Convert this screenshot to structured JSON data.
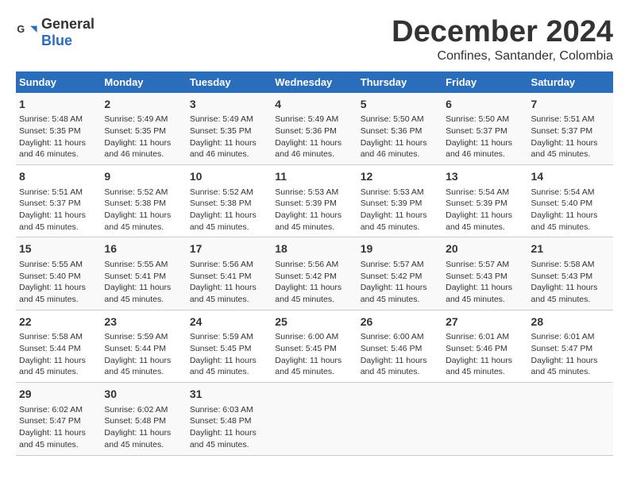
{
  "logo": {
    "general": "General",
    "blue": "Blue"
  },
  "title": "December 2024",
  "location": "Confines, Santander, Colombia",
  "days_header": [
    "Sunday",
    "Monday",
    "Tuesday",
    "Wednesday",
    "Thursday",
    "Friday",
    "Saturday"
  ],
  "weeks": [
    [
      {
        "day": 1,
        "rise": "5:48 AM",
        "set": "5:35 PM",
        "daylight": "11 hours and 46 minutes."
      },
      {
        "day": 2,
        "rise": "5:49 AM",
        "set": "5:35 PM",
        "daylight": "11 hours and 46 minutes."
      },
      {
        "day": 3,
        "rise": "5:49 AM",
        "set": "5:35 PM",
        "daylight": "11 hours and 46 minutes."
      },
      {
        "day": 4,
        "rise": "5:49 AM",
        "set": "5:36 PM",
        "daylight": "11 hours and 46 minutes."
      },
      {
        "day": 5,
        "rise": "5:50 AM",
        "set": "5:36 PM",
        "daylight": "11 hours and 46 minutes."
      },
      {
        "day": 6,
        "rise": "5:50 AM",
        "set": "5:37 PM",
        "daylight": "11 hours and 46 minutes."
      },
      {
        "day": 7,
        "rise": "5:51 AM",
        "set": "5:37 PM",
        "daylight": "11 hours and 45 minutes."
      }
    ],
    [
      {
        "day": 8,
        "rise": "5:51 AM",
        "set": "5:37 PM",
        "daylight": "11 hours and 45 minutes."
      },
      {
        "day": 9,
        "rise": "5:52 AM",
        "set": "5:38 PM",
        "daylight": "11 hours and 45 minutes."
      },
      {
        "day": 10,
        "rise": "5:52 AM",
        "set": "5:38 PM",
        "daylight": "11 hours and 45 minutes."
      },
      {
        "day": 11,
        "rise": "5:53 AM",
        "set": "5:39 PM",
        "daylight": "11 hours and 45 minutes."
      },
      {
        "day": 12,
        "rise": "5:53 AM",
        "set": "5:39 PM",
        "daylight": "11 hours and 45 minutes."
      },
      {
        "day": 13,
        "rise": "5:54 AM",
        "set": "5:39 PM",
        "daylight": "11 hours and 45 minutes."
      },
      {
        "day": 14,
        "rise": "5:54 AM",
        "set": "5:40 PM",
        "daylight": "11 hours and 45 minutes."
      }
    ],
    [
      {
        "day": 15,
        "rise": "5:55 AM",
        "set": "5:40 PM",
        "daylight": "11 hours and 45 minutes."
      },
      {
        "day": 16,
        "rise": "5:55 AM",
        "set": "5:41 PM",
        "daylight": "11 hours and 45 minutes."
      },
      {
        "day": 17,
        "rise": "5:56 AM",
        "set": "5:41 PM",
        "daylight": "11 hours and 45 minutes."
      },
      {
        "day": 18,
        "rise": "5:56 AM",
        "set": "5:42 PM",
        "daylight": "11 hours and 45 minutes."
      },
      {
        "day": 19,
        "rise": "5:57 AM",
        "set": "5:42 PM",
        "daylight": "11 hours and 45 minutes."
      },
      {
        "day": 20,
        "rise": "5:57 AM",
        "set": "5:43 PM",
        "daylight": "11 hours and 45 minutes."
      },
      {
        "day": 21,
        "rise": "5:58 AM",
        "set": "5:43 PM",
        "daylight": "11 hours and 45 minutes."
      }
    ],
    [
      {
        "day": 22,
        "rise": "5:58 AM",
        "set": "5:44 PM",
        "daylight": "11 hours and 45 minutes."
      },
      {
        "day": 23,
        "rise": "5:59 AM",
        "set": "5:44 PM",
        "daylight": "11 hours and 45 minutes."
      },
      {
        "day": 24,
        "rise": "5:59 AM",
        "set": "5:45 PM",
        "daylight": "11 hours and 45 minutes."
      },
      {
        "day": 25,
        "rise": "6:00 AM",
        "set": "5:45 PM",
        "daylight": "11 hours and 45 minutes."
      },
      {
        "day": 26,
        "rise": "6:00 AM",
        "set": "5:46 PM",
        "daylight": "11 hours and 45 minutes."
      },
      {
        "day": 27,
        "rise": "6:01 AM",
        "set": "5:46 PM",
        "daylight": "11 hours and 45 minutes."
      },
      {
        "day": 28,
        "rise": "6:01 AM",
        "set": "5:47 PM",
        "daylight": "11 hours and 45 minutes."
      }
    ],
    [
      {
        "day": 29,
        "rise": "6:02 AM",
        "set": "5:47 PM",
        "daylight": "11 hours and 45 minutes."
      },
      {
        "day": 30,
        "rise": "6:02 AM",
        "set": "5:48 PM",
        "daylight": "11 hours and 45 minutes."
      },
      {
        "day": 31,
        "rise": "6:03 AM",
        "set": "5:48 PM",
        "daylight": "11 hours and 45 minutes."
      },
      null,
      null,
      null,
      null
    ]
  ]
}
